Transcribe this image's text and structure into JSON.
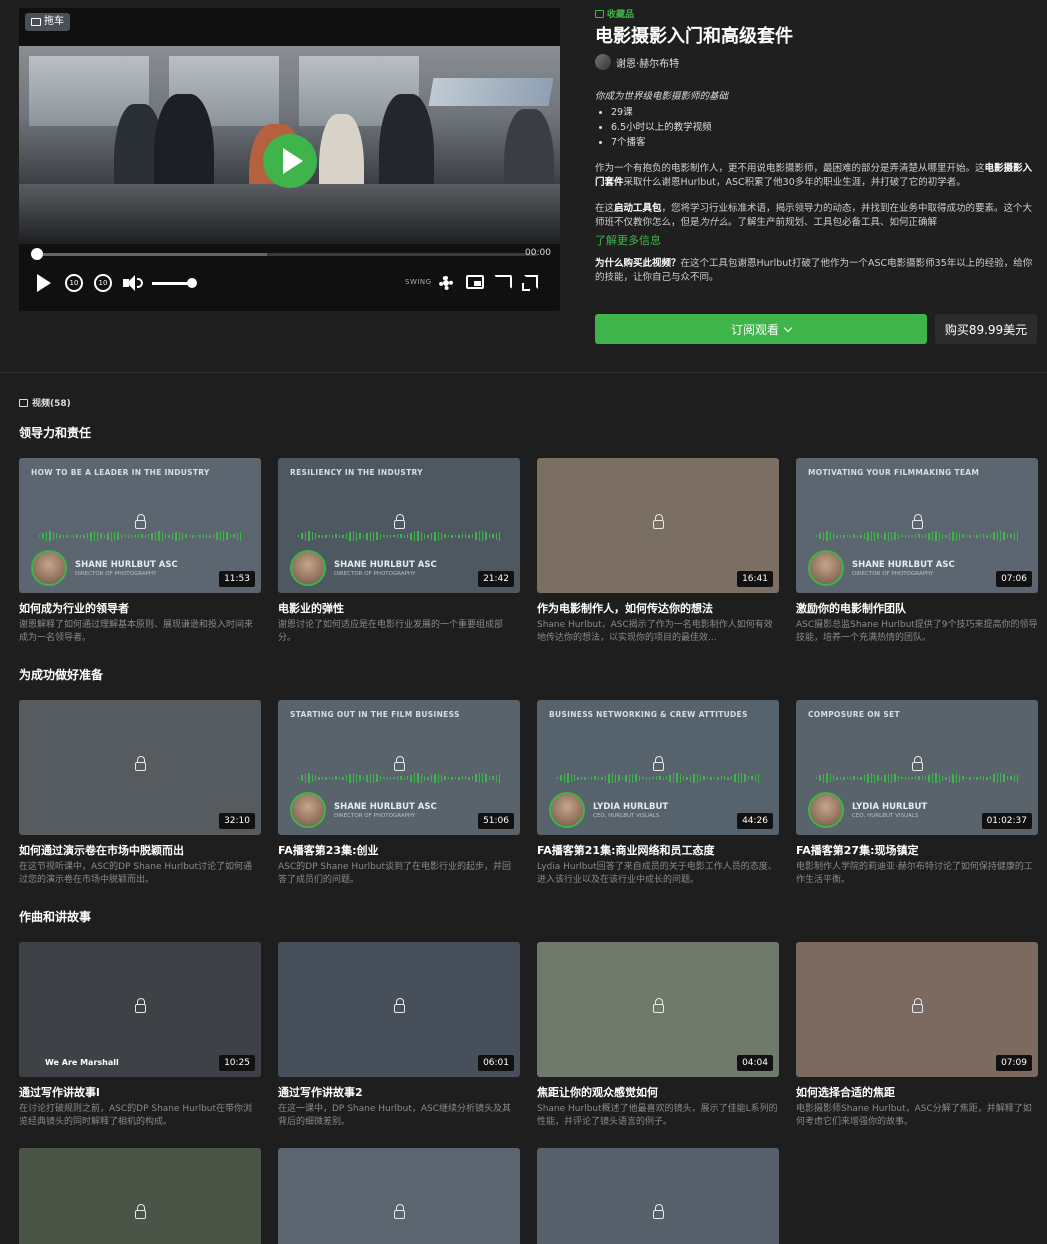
{
  "player": {
    "badge": "拖车",
    "time": "00:00",
    "brand": "SWING"
  },
  "info": {
    "tag": "收藏品",
    "title": "电影摄影入门和高级套件",
    "instructor": "谢恩·赫尔布特",
    "tagline": "你成为世界级电影摄影师的基础",
    "bullets": [
      "29课",
      "6.5小时以上的教学视频",
      "7个播客"
    ],
    "para1_a": "作为一个有抱负的电影制作人，更不用说电影摄影师，最困难的部分是弄清楚从哪里开始。这",
    "para1_b": "电影摄影入门套件",
    "para1_c": "采取什么谢恩Hurlbut，ASC积累了他30多年的职业生涯，并打破了它的初学者。",
    "para2_a": "在这",
    "para2_b": "启动工具包",
    "para2_c": "，您将学习行业标准术语，揭示领导力的动态，并找到在业务中取得成功的要素。这个大师班不仅教你怎么，但是",
    "para2_d": "为什么",
    "para2_e": "。了解生产前规划、工具包必备工具、如何正确解",
    "learn_more": "了解更多信息",
    "why_a": "为什么购买此视频？",
    "why_b": "在这个工具包谢恩Hurlbut打破了他作为一个ASC电影摄影师35年以上的经验，给你的技能，让你自己与众不同。",
    "subscribe": "订阅观看",
    "buy": "购买89.99美元"
  },
  "videos_header": "视频(58)",
  "sections": [
    {
      "title": "领导力和责任",
      "cards": [
        {
          "thumb_title": "HOW TO BE A LEADER IN THE INDUSTRY",
          "speaker": "SHANE HURLBUT ASC",
          "role": "DIRECTOR OF PHOTOGRAPHY",
          "duration": "11:53",
          "title": "如何成为行业的领导者",
          "desc": "谢恩解释了如何通过理解基本原则、展现谦逊和投入时间来成为一名领导者。"
        },
        {
          "thumb_title": "RESILIENCY IN THE INDUSTRY",
          "speaker": "SHANE HURLBUT ASC",
          "role": "DIRECTOR OF PHOTOGRAPHY",
          "duration": "21:42",
          "title": "电影业的弹性",
          "desc": "谢恩讨论了如何适应是在电影行业发展的一个重要组成部分。"
        },
        {
          "thumb_title": "",
          "speaker": "",
          "role": "",
          "duration": "16:41",
          "title": "作为电影制作人，如何传达你的想法",
          "desc": "Shane Hurlbut，ASC揭示了作为一名电影制作人如何有效地传达你的想法，以实现你的项目的最佳效..."
        },
        {
          "thumb_title": "MOTIVATING YOUR FILMMAKING TEAM",
          "speaker": "SHANE HURLBUT ASC",
          "role": "DIRECTOR OF PHOTOGRAPHY",
          "duration": "07:06",
          "title": "激励你的电影制作团队",
          "desc": "ASC摄影总监Shane Hurlbut提供了9个技巧来提高你的领导技能，培养一个充满热情的团队。"
        }
      ]
    },
    {
      "title": "为成功做好准备",
      "cards": [
        {
          "thumb_title": "",
          "speaker": "",
          "role": "",
          "duration": "32:10",
          "title": "如何通过演示卷在市场中脱颖而出",
          "desc": "在这节视听课中，ASC的DP Shane Hurlbut讨论了如何通过您的演示卷在市场中脱颖而出。"
        },
        {
          "thumb_title": "STARTING OUT IN THE FILM BUSINESS",
          "speaker": "SHANE HURLBUT ASC",
          "role": "DIRECTOR OF PHOTOGRAPHY",
          "duration": "51:06",
          "title": "FA播客第23集:创业",
          "desc": "ASC的DP Shane Hurlbut谈到了在电影行业的起步，并回答了成员们的问题。"
        },
        {
          "thumb_title": "BUSINESS NETWORKING & CREW ATTITUDES",
          "speaker": "LYDIA HURLBUT",
          "role": "CEO, HURLBUT VISUALS",
          "duration": "44:26",
          "title": "FA播客第21集:商业网络和员工态度",
          "desc": "Lydia Hurlbut回答了来自成员的关于电影工作人员的态度、进入该行业以及在该行业中成长的问题。"
        },
        {
          "thumb_title": "COMPOSURE ON SET",
          "speaker": "LYDIA HURLBUT",
          "role": "CEO, HURLBUT VISUALS",
          "duration": "01:02:37",
          "title": "FA播客第27集:现场镇定",
          "desc": "电影制作人学院的莉迪亚·赫尔布特讨论了如何保持健康的工作生活平衡。"
        }
      ]
    },
    {
      "title": "作曲和讲故事",
      "cards": [
        {
          "thumb_title": "",
          "speaker": "",
          "role": "",
          "extra": "We Are Marshall",
          "duration": "10:25",
          "title": "通过写作讲故事l",
          "desc": "在讨论打破规则之前，ASC的DP Shane Hurlbut在带你浏览经典镜头的同时解释了相机的构成。"
        },
        {
          "thumb_title": "",
          "speaker": "",
          "role": "",
          "duration": "06:01",
          "title": "通过写作讲故事2",
          "desc": "在这一课中，DP Shane Hurlbut，ASC继续分析镜头及其背后的细微差别。"
        },
        {
          "thumb_title": "",
          "speaker": "",
          "role": "",
          "duration": "04:04",
          "title": "焦距让你的观众感觉如何",
          "desc": "Shane Hurlbut概述了他最喜欢的镜头，展示了佳能L系列的性能，并评论了镜头语言的例子。"
        },
        {
          "thumb_title": "",
          "speaker": "",
          "role": "",
          "duration": "07:09",
          "title": "如何选择合适的焦距",
          "desc": "电影摄影师Shane Hurlbut，ASC分解了焦距，并解释了如何考虑它们来增强你的故事。"
        }
      ]
    }
  ]
}
